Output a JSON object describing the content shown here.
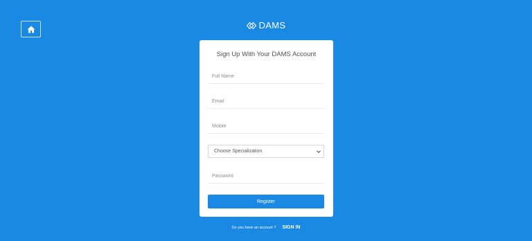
{
  "brand": {
    "name": "DAMS",
    "icon": "diamond-link-icon"
  },
  "nav": {
    "home_icon": "home-icon"
  },
  "form": {
    "title": "Sign Up With Your DAMS Account",
    "full_name_placeholder": "Full Name",
    "email_placeholder": "Email",
    "mobile_placeholder": "Mobile",
    "specialization_selected": "Choose Specialization",
    "password_placeholder": "Password",
    "register_label": "Register"
  },
  "footer": {
    "question": "Do you have an account ?",
    "signin_label": "SIGN IN"
  },
  "colors": {
    "background": "#1a89e3",
    "card": "#ffffff",
    "button": "#1a89e3"
  }
}
